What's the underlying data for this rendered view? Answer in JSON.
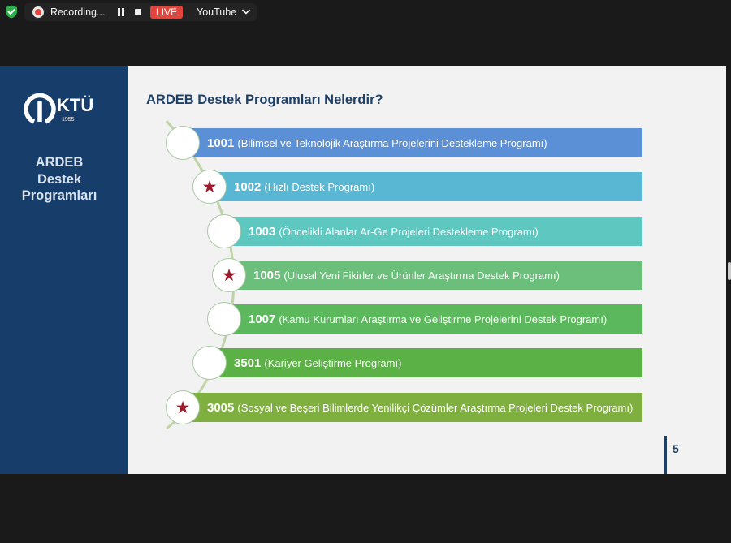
{
  "toolbar": {
    "recording_label": "Recording...",
    "live_label": "LIVE",
    "stream_target": "YouTube",
    "icons": {
      "security": "shield-check-icon",
      "recording": "record-dot-icon",
      "pause": "pause-icon",
      "stop": "stop-icon",
      "dropdown": "chevron-down-icon"
    },
    "colors": {
      "live": "#e0463e",
      "shield": "#2fb04a"
    }
  },
  "slide": {
    "logo": {
      "text": "KTÜ",
      "year": "1955"
    },
    "sidebar_title": [
      "ARDEB",
      "Destek",
      "Programları"
    ],
    "heading": "ARDEB Destek Programları Nelerdir?",
    "page_number": "5",
    "colors": {
      "sidebar": "#173d6a",
      "heading": "#1e3f66",
      "star": "#9b1b2b"
    },
    "programs": [
      {
        "code": "1001",
        "desc": "(Bilimsel ve Teknolojik Araştırma Projelerini Destekleme Programı)",
        "starred": false,
        "color": "#5b8fd6"
      },
      {
        "code": "1002",
        "desc": "(Hızlı Destek Programı)",
        "starred": true,
        "color": "#5ab7d3"
      },
      {
        "code": "1003",
        "desc": "(Öncelikli Alanlar Ar-Ge Projeleri Destekleme Programı)",
        "starred": false,
        "color": "#5ec7c0"
      },
      {
        "code": "1005",
        "desc": "(Ulusal Yeni Fikirler ve Ürünler Araştırma Destek Programı)",
        "starred": true,
        "color": "#6cbf7a"
      },
      {
        "code": "1007",
        "desc": "(Kamu Kurumları Araştırma ve Geliştirme Projelerini Destek Programı)",
        "starred": false,
        "color": "#5cb85c"
      },
      {
        "code": "3501",
        "desc": "(Kariyer Geliştirme Programı)",
        "starred": false,
        "color": "#5cb146"
      },
      {
        "code": "3005",
        "desc": "(Sosyal ve Beşeri Bilimlerde Yenilikçi Çözümler Araştırma Projeleri Destek Programı)",
        "starred": true,
        "color": "#7fb03f"
      }
    ]
  }
}
